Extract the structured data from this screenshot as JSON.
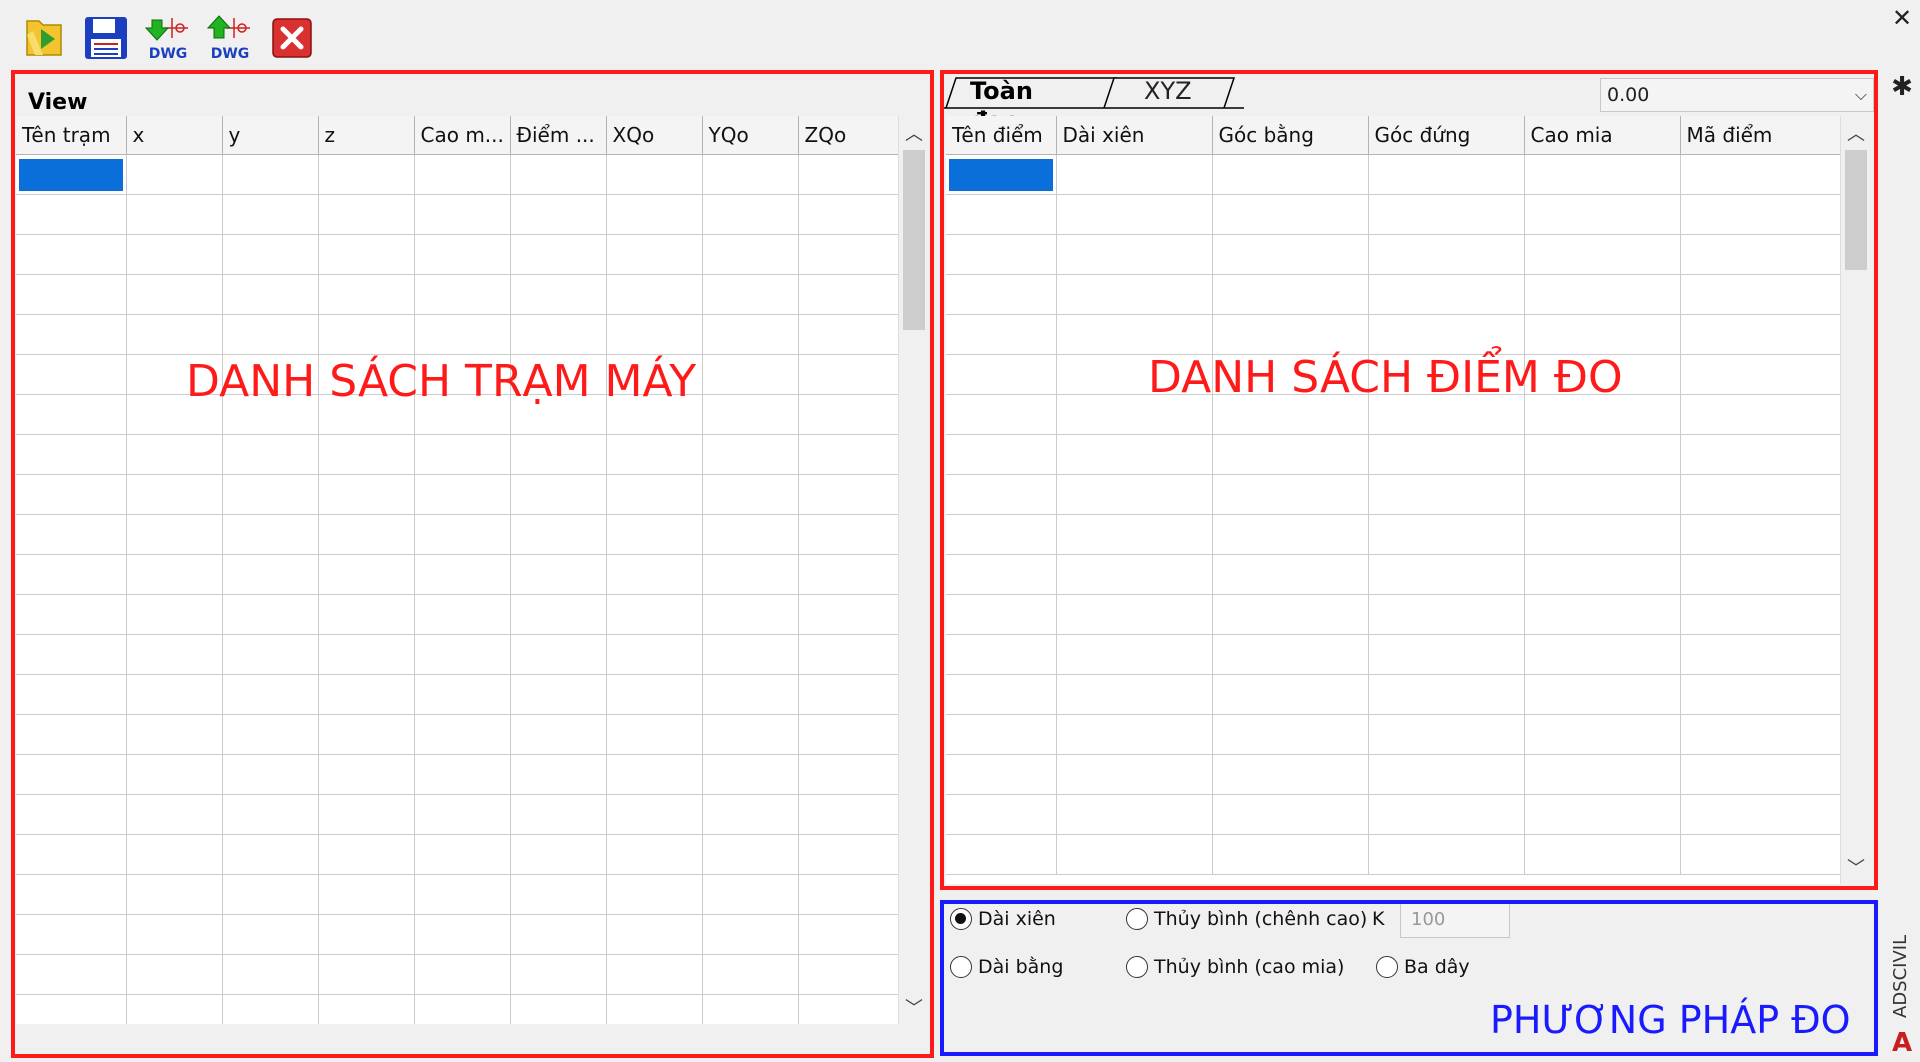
{
  "toolbar": {
    "buttons": [
      {
        "icon": "open-folder-icon"
      },
      {
        "icon": "save-disk-icon"
      },
      {
        "icon": "import-dwg-icon",
        "label": "DWG"
      },
      {
        "icon": "export-dwg-icon",
        "label": "DWG"
      },
      {
        "icon": "close-red-x-icon"
      }
    ]
  },
  "left_panel": {
    "title": "View",
    "columns": [
      "Tên trạm",
      "x",
      "y",
      "z",
      "Cao m...",
      "Điểm ...",
      "XQo",
      "YQo",
      "ZQo"
    ],
    "overlay": "DANH SÁCH TRẠM MÁY"
  },
  "right_panel": {
    "tabs": [
      "Toàn đạc",
      "XYZ"
    ],
    "combo_value": "0.00",
    "columns": [
      "Tên điểm",
      "Dài xiên",
      "Góc bằng",
      "Góc đứng",
      "Cao mia",
      "Mã điểm"
    ],
    "overlay": "DANH SÁCH ĐIỂM ĐO"
  },
  "methods": {
    "options": [
      {
        "label": "Dài xiên",
        "selected": true
      },
      {
        "label": "Thủy bình (chênh cao)",
        "selected": false
      },
      {
        "label": "Dài bằng",
        "selected": false
      },
      {
        "label": "Thủy bình (cao mia)",
        "selected": false
      },
      {
        "label": "Ba dây",
        "selected": false
      }
    ],
    "k_label": "K",
    "k_value": "100",
    "overlay": "PHƯƠNG PHÁP ĐO"
  },
  "side": {
    "close_glyph": "✕",
    "settings_glyph": "✱",
    "vertical_text": "ADSCIVIL",
    "logo_glyph": "A"
  },
  "colors": {
    "annotation_red": "#ff1a1a",
    "annotation_blue": "#1a1aff",
    "selection": "#0a6fd8"
  }
}
